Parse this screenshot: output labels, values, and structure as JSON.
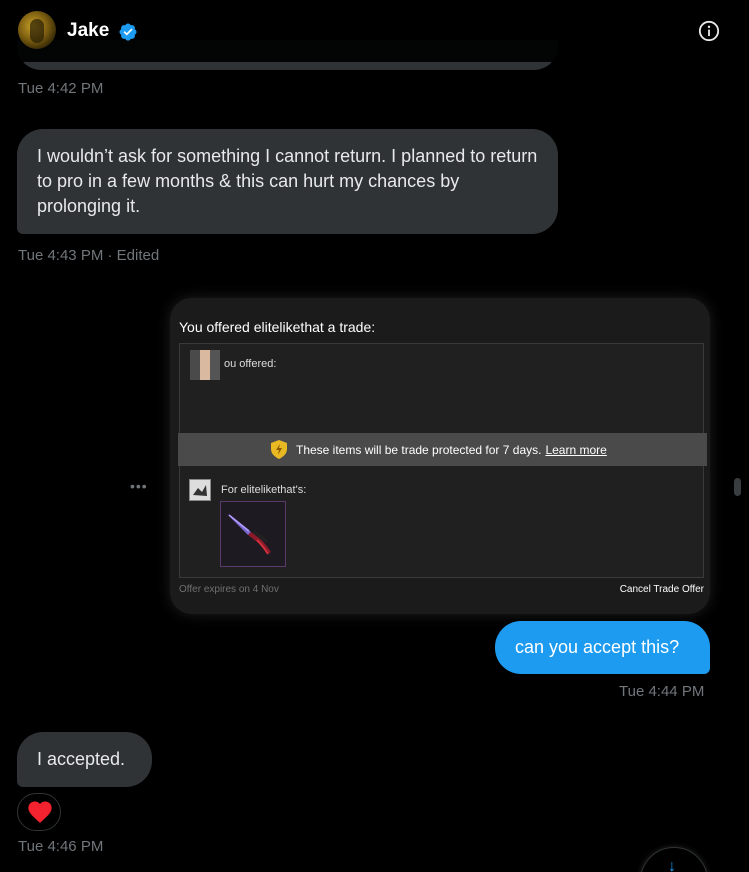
{
  "header": {
    "name": "Jake",
    "avatar_icon": "avatar-image",
    "verified_icon": "verified-badge-icon",
    "info_icon": "info-icon"
  },
  "messages": [
    {
      "id": "m0",
      "timestamp": "Tue 4:42 PM"
    },
    {
      "id": "m1",
      "text": "I wouldn’t ask for something I cannot return. I planned to return to pro in a few months & this can hurt my chances by prolonging it.",
      "timestamp": "Tue 4:43 PM · Edited"
    },
    {
      "id": "m2",
      "trade": {
        "title": "You offered elitelikethat a trade:",
        "you_offered": "ou offered:",
        "protection_text": "These items will be trade protected for 7 days.",
        "learn_more": "Learn more",
        "for_label": "For elitelikethat's:",
        "expires": "Offer expires on 4 Nov",
        "cancel": "Cancel Trade Offer"
      }
    },
    {
      "id": "m3",
      "text": "can you accept this?",
      "timestamp": "Tue 4:44 PM"
    },
    {
      "id": "m4",
      "text": "I accepted.",
      "timestamp": "Tue 4:46 PM",
      "reaction": "heart"
    }
  ],
  "more_options": "•••",
  "scroll_down_icon": "arrow-down-icon",
  "colors": {
    "accent": "#1d9bf0",
    "bubble_in": "#2f3336",
    "muted": "#71767b",
    "heart": "#f91880"
  }
}
